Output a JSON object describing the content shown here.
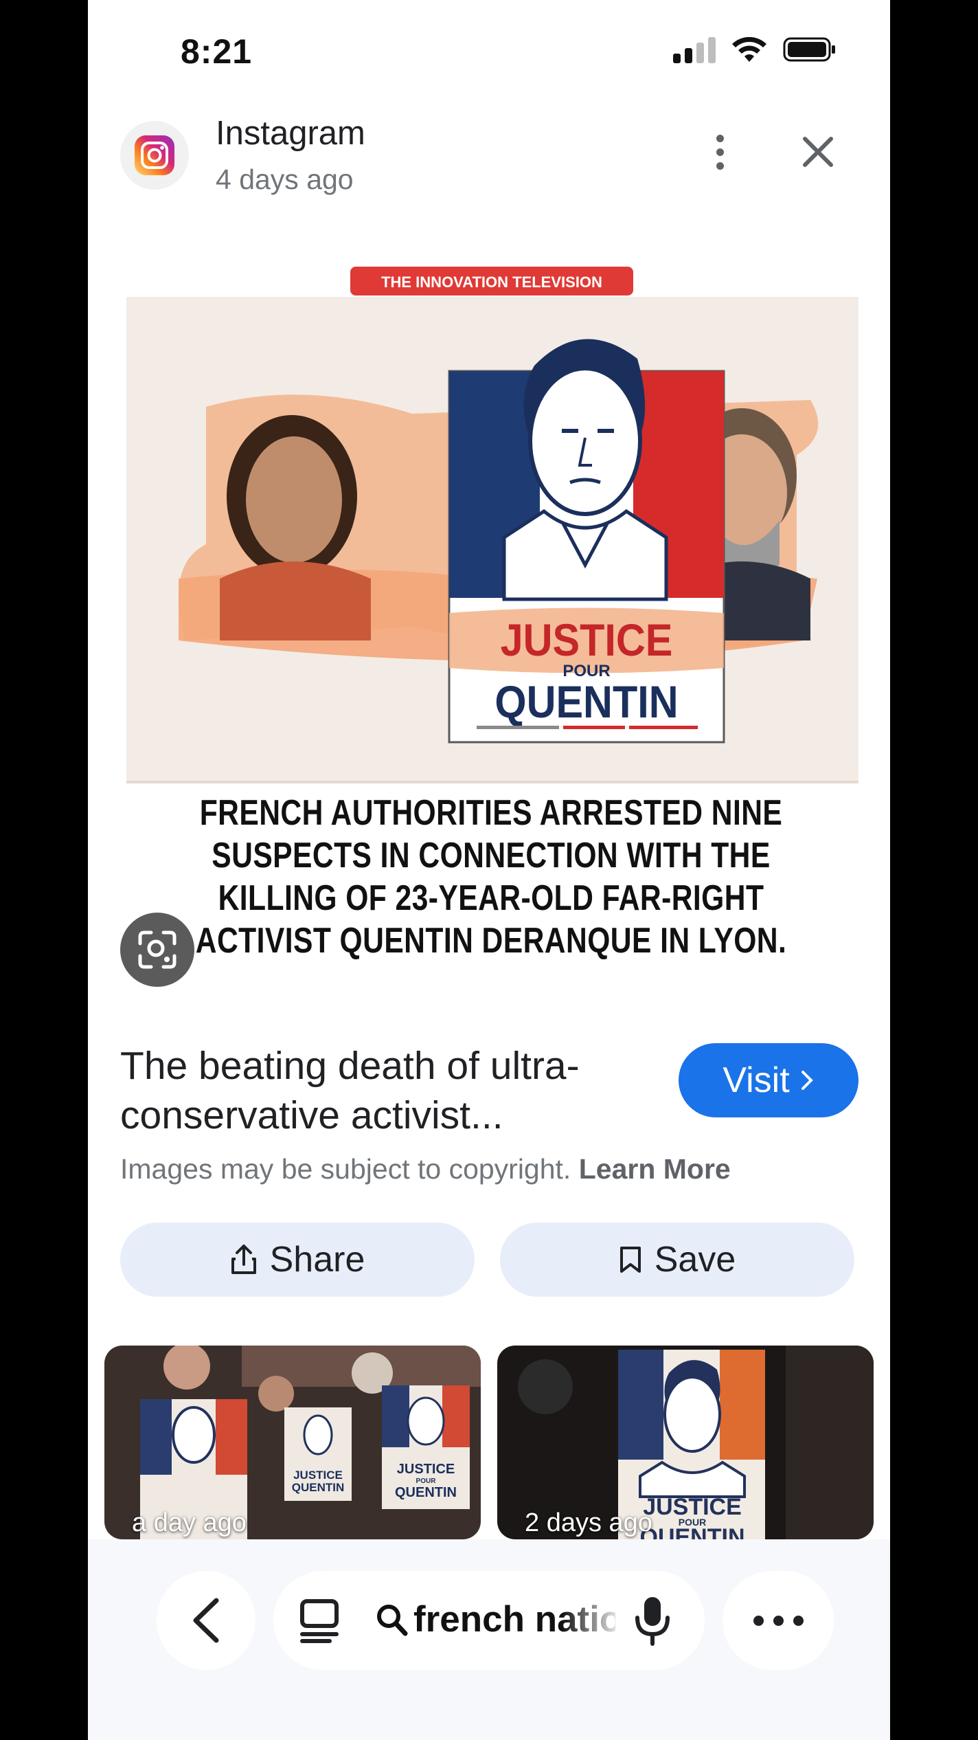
{
  "status_bar": {
    "time": "8:21"
  },
  "header": {
    "source_name": "Instagram",
    "source_date": "4 days ago",
    "more_icon": "more-vert-icon",
    "close_icon": "close-icon"
  },
  "image": {
    "banner": "THE INNOVATION TELEVISION",
    "poster_line1": "JUSTICE",
    "poster_line2": "POUR",
    "poster_line3": "QUENTIN",
    "caption": "FRENCH AUTHORITIES ARRESTED NINE SUSPECTS IN CONNECTION WITH THE KILLING OF 23-YEAR-OLD FAR-RIGHT ACTIVIST QUENTIN DERANQUE IN LYON."
  },
  "result": {
    "title_line1": "The beating death of ultra-",
    "title_line2": "conservative activist...",
    "visit_label": "Visit",
    "copyright_text": "Images may be subject to copyright.",
    "learn_more": "Learn More"
  },
  "actions": {
    "share_label": "Share",
    "save_label": "Save"
  },
  "related": [
    {
      "label": "a day ago",
      "poster_line1": "JUSTICE",
      "poster_line2": "POUR",
      "poster_line3": "QUENTIN"
    },
    {
      "label": "2 days ago",
      "poster_line1": "JUSTICE",
      "poster_line2": "POUR",
      "poster_line3": "QUENTIN"
    }
  ],
  "bottom_bar": {
    "search_query": "french natio"
  },
  "colors": {
    "accent": "#1a73e8",
    "pill_bg": "#e8eef9",
    "poster_blue": "#1f3b73",
    "poster_red": "#d62b2b"
  }
}
